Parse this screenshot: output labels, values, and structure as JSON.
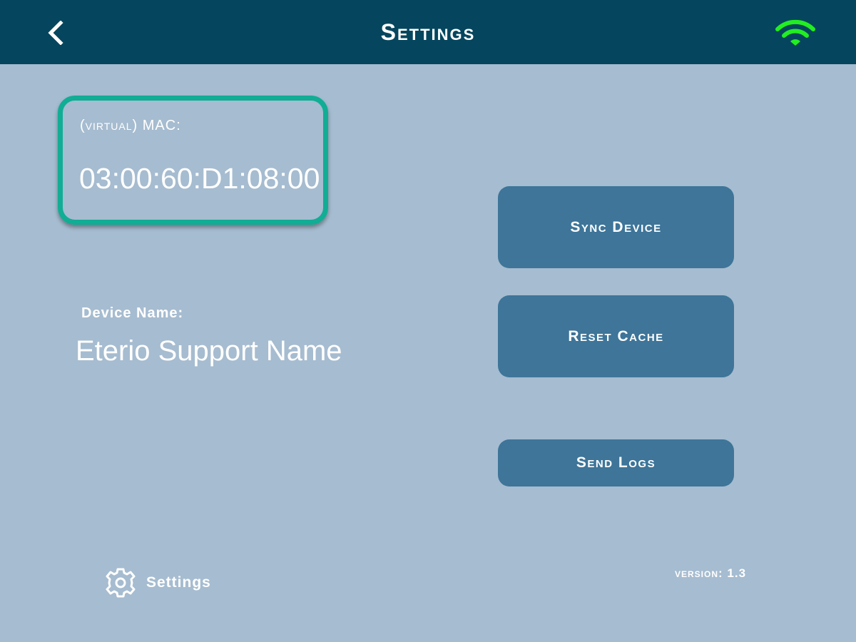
{
  "header": {
    "title": "Settings",
    "back_icon": "chevron-left-icon",
    "status_icon": "wifi-icon",
    "status_color": "#22ee22",
    "background": "#05465e"
  },
  "mac": {
    "label": "(virtual) MAC:",
    "value": "03:00:60:D1:08:00",
    "border_color": "#11ad94"
  },
  "device": {
    "label": "Device Name:",
    "value": "Eterio Support Name"
  },
  "actions": {
    "sync_label": "Sync Device",
    "reset_label": "Reset Cache",
    "logs_label": "Send Logs",
    "button_color": "#3e7599"
  },
  "footer": {
    "settings_icon": "gear-icon",
    "settings_label": "Settings",
    "version_label": "version:",
    "version_value": "1.3"
  }
}
